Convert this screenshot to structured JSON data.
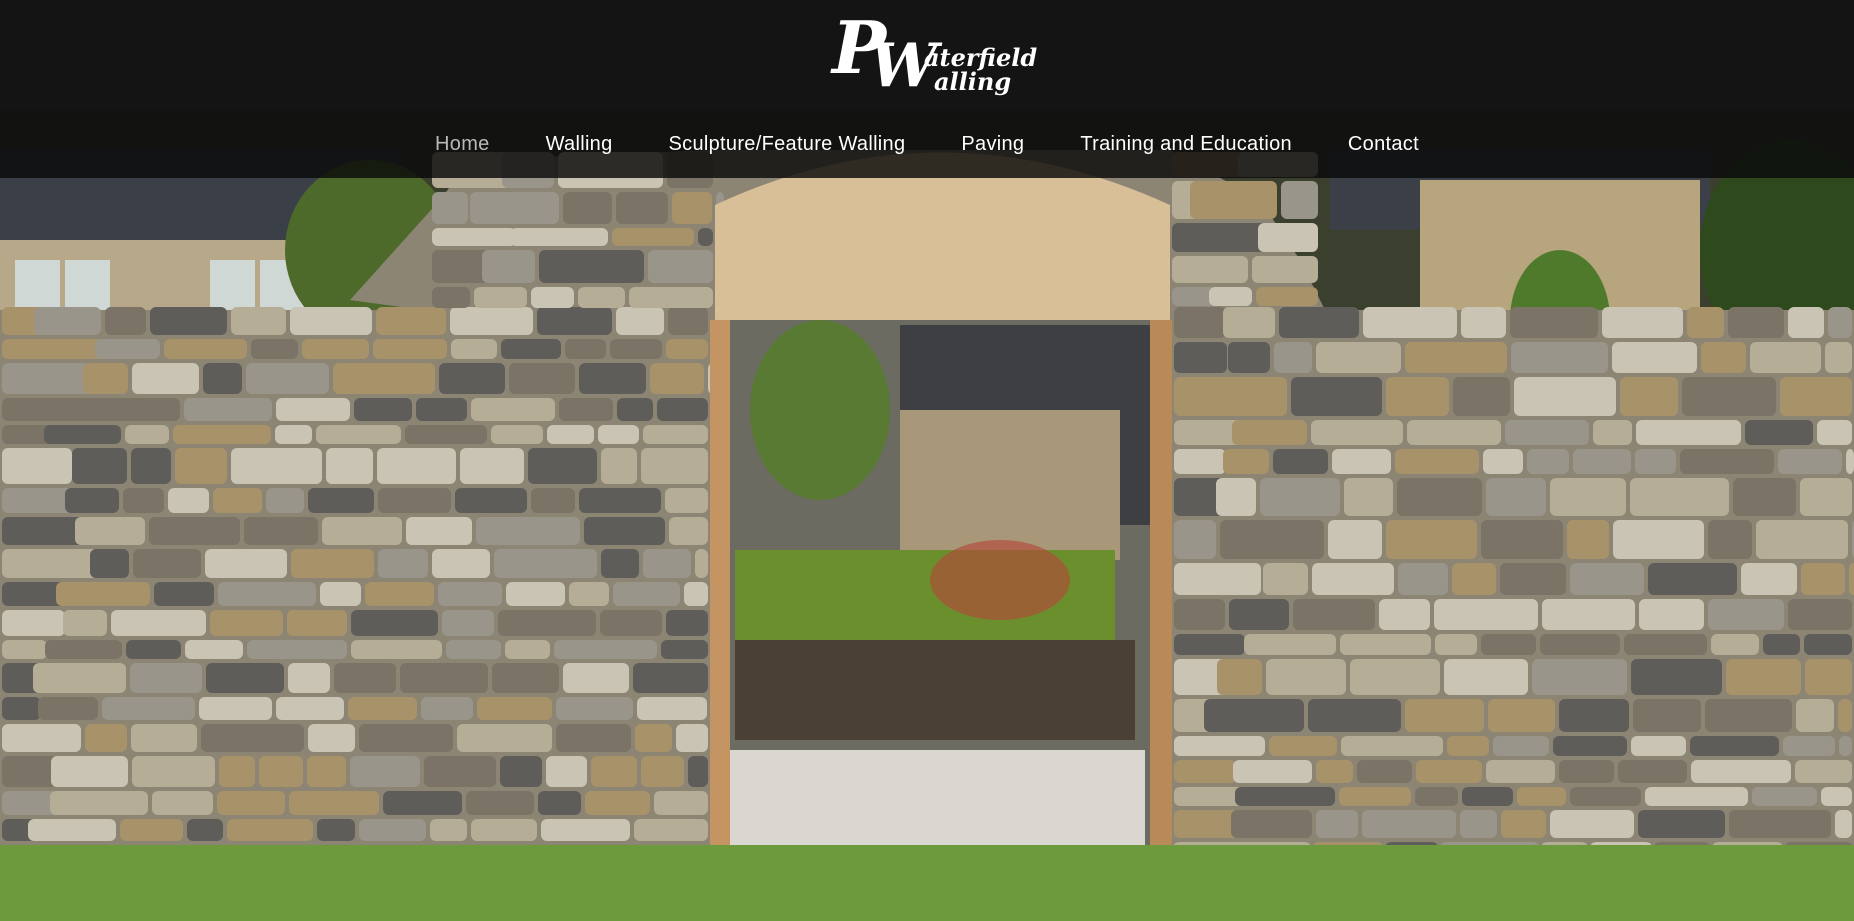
{
  "brand": {
    "logo_initial": "P",
    "logo_second_initial": "W",
    "logo_line1": "aterfield",
    "logo_line2": "alling"
  },
  "nav": {
    "items": [
      {
        "label": "Home",
        "active": true
      },
      {
        "label": "Walling",
        "active": false
      },
      {
        "label": "Sculpture/Feature Walling",
        "active": false
      },
      {
        "label": "Paving",
        "active": false
      },
      {
        "label": "Training and Education",
        "active": false
      },
      {
        "label": "Contact",
        "active": false
      }
    ]
  },
  "colors": {
    "header_bg": "#141414",
    "nav_active": "#b9b9b9",
    "nav_text": "#ffffff",
    "stone_light": "#c9c4b3",
    "stone_tan": "#a8926a",
    "stone_dark": "#5e5d5a",
    "arch_board": "#d8bf97",
    "grass": "#6d9a3c",
    "sky_roof": "#3b4048"
  },
  "hero": {
    "image_subject": "dry-stone-wall-with-arched-doorway"
  }
}
